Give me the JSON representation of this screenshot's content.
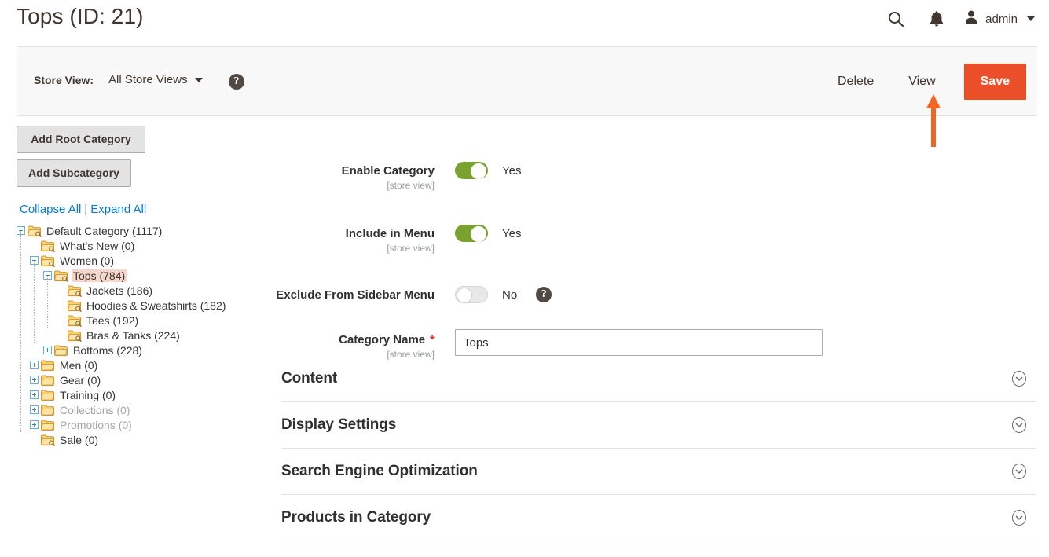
{
  "header": {
    "page_title": "Tops (ID: 21)",
    "search_icon": "search-icon",
    "notifications_icon": "bell-icon",
    "user_name": "admin",
    "user_icon": "user-avatar-icon",
    "user_caret": "chevron-down-icon"
  },
  "page_actions": {
    "store_view_label": "Store View:",
    "store_view_value": "All Store Views",
    "help_icon": "question-mark-icon",
    "delete_label": "Delete",
    "view_label": "View",
    "save_label": "Save",
    "primary_color": "#ea4f29"
  },
  "annotation": {
    "arrow_color": "#f26522",
    "points_at": "View"
  },
  "tree_panel": {
    "add_root_label": "Add Root Category",
    "add_sub_label": "Add Subcategory",
    "collapse_all_label": "Collapse All",
    "separator": "|",
    "expand_all_label": "Expand All",
    "link_color": "#007bdb",
    "selected_highlight": "#f8d5cb",
    "nodes": [
      {
        "label": "Default Category (1117)",
        "depth": 0,
        "twist": "minus",
        "state": "normal"
      },
      {
        "label": "What's New (0)",
        "depth": 1,
        "twist": "none",
        "state": "normal"
      },
      {
        "label": "Women (0)",
        "depth": 1,
        "twist": "minus",
        "state": "normal"
      },
      {
        "label": "Tops (784)",
        "depth": 2,
        "twist": "minus",
        "state": "selected"
      },
      {
        "label": "Jackets (186)",
        "depth": 3,
        "twist": "none",
        "state": "normal"
      },
      {
        "label": "Hoodies & Sweatshirts (182)",
        "depth": 3,
        "twist": "none",
        "state": "normal"
      },
      {
        "label": "Tees (192)",
        "depth": 3,
        "twist": "none",
        "state": "normal"
      },
      {
        "label": "Bras & Tanks (224)",
        "depth": 3,
        "twist": "none",
        "state": "normal"
      },
      {
        "label": "Bottoms (228)",
        "depth": 2,
        "twist": "plus",
        "state": "normal"
      },
      {
        "label": "Men (0)",
        "depth": 1,
        "twist": "plus",
        "state": "normal"
      },
      {
        "label": "Gear (0)",
        "depth": 1,
        "twist": "plus",
        "state": "normal"
      },
      {
        "label": "Training (0)",
        "depth": 1,
        "twist": "plus",
        "state": "normal"
      },
      {
        "label": "Collections (0)",
        "depth": 1,
        "twist": "plus",
        "state": "disabled"
      },
      {
        "label": "Promotions (0)",
        "depth": 1,
        "twist": "plus",
        "state": "disabled"
      },
      {
        "label": "Sale (0)",
        "depth": 1,
        "twist": "none",
        "state": "normal"
      }
    ]
  },
  "form": {
    "scope_note": "[store view]",
    "enable_category": {
      "label": "Enable Category",
      "scope": "[store view]",
      "value": "Yes",
      "state": "on"
    },
    "include_in_menu": {
      "label": "Include in Menu",
      "scope": "[store view]",
      "value": "Yes",
      "state": "on"
    },
    "exclude_from_sidebar": {
      "label": "Exclude From Sidebar Menu",
      "value": "No",
      "state": "off",
      "help_icon": "question-mark-icon"
    },
    "category_name": {
      "label": "Category Name",
      "required_marker": "*",
      "scope": "[store view]",
      "value": "Tops",
      "placeholder": ""
    }
  },
  "sections": [
    {
      "title": "Content",
      "expanded": false,
      "chevron": "chevron-down-circle-icon"
    },
    {
      "title": "Display Settings",
      "expanded": false,
      "chevron": "chevron-down-circle-icon"
    },
    {
      "title": "Search Engine Optimization",
      "expanded": false,
      "chevron": "chevron-down-circle-icon"
    },
    {
      "title": "Products in Category",
      "expanded": false,
      "chevron": "chevron-down-circle-icon"
    }
  ]
}
